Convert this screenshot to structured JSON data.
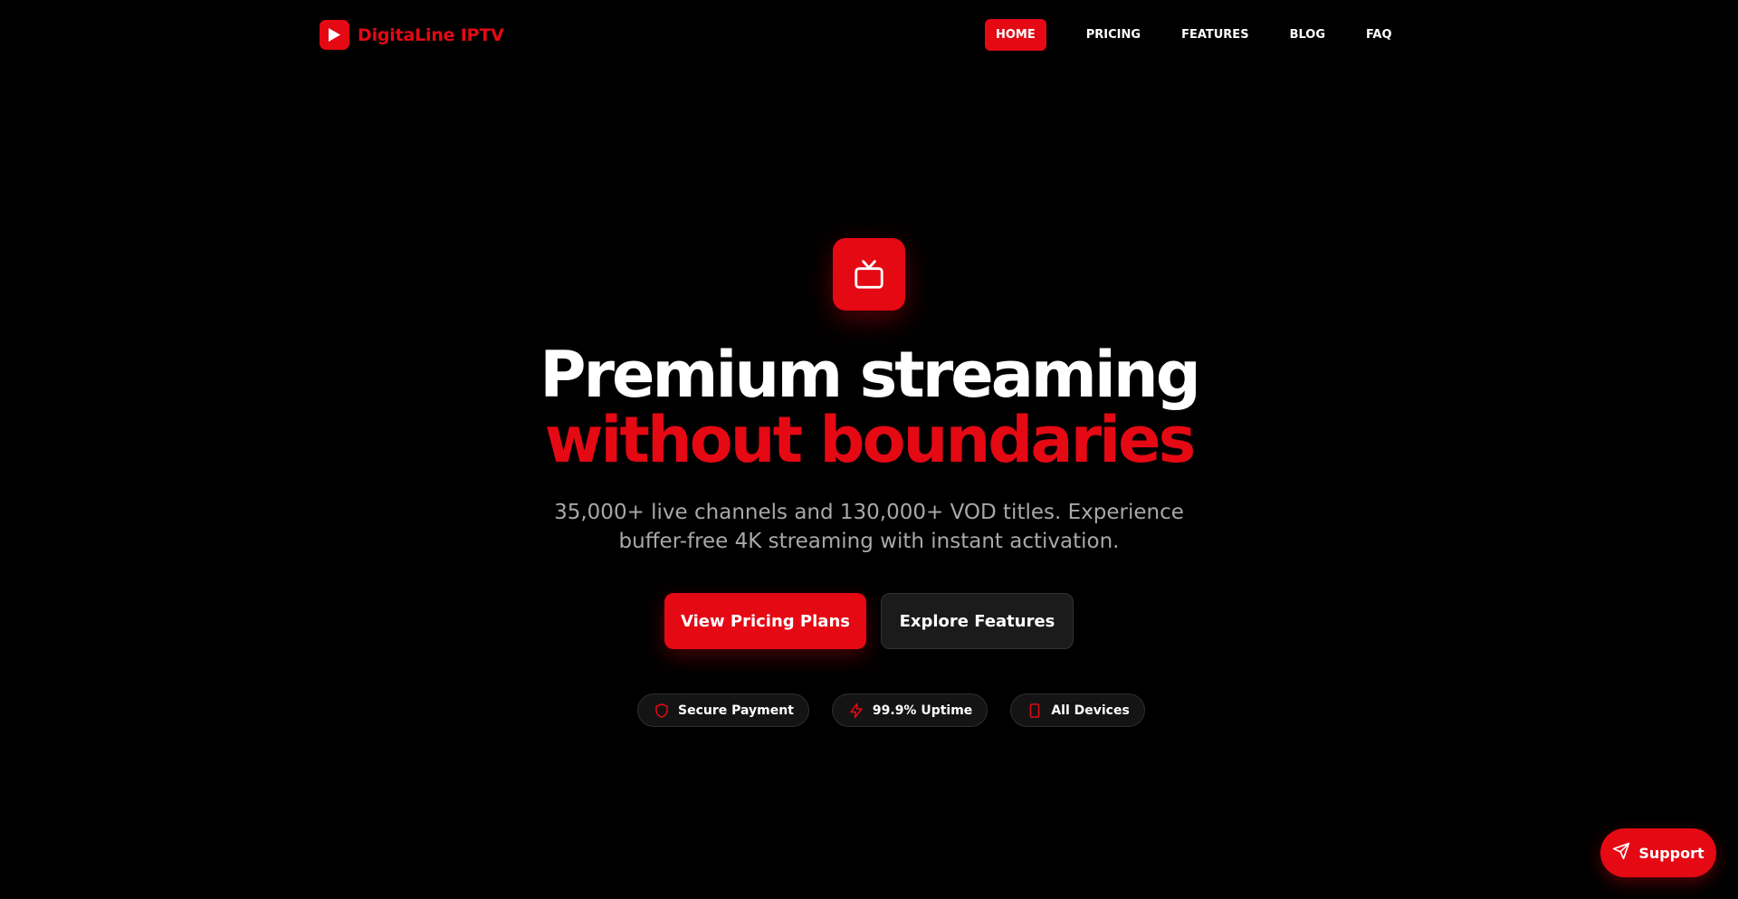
{
  "brand": {
    "name": "DigitaLine IPTV",
    "accent_color": "#e50914",
    "logo_icon": "play-icon"
  },
  "nav": {
    "items": [
      {
        "label": "HOME",
        "active": true
      },
      {
        "label": "PRICING",
        "active": false
      },
      {
        "label": "FEATURES",
        "active": false
      },
      {
        "label": "BLOG",
        "active": false
      },
      {
        "label": "FAQ",
        "active": false
      }
    ]
  },
  "hero": {
    "icon": "tv-icon",
    "title_line1": "Premium streaming",
    "title_line2": "without boundaries",
    "subtitle": "35,000+ live channels and 130,000+ VOD titles. Experience buffer-free 4K streaming with instant activation.",
    "primary_cta": "View Pricing Plans",
    "secondary_cta": "Explore Features"
  },
  "badges": [
    {
      "icon": "shield-icon",
      "label": "Secure Payment"
    },
    {
      "icon": "lightning-icon",
      "label": "99.9% Uptime"
    },
    {
      "icon": "smartphone-icon",
      "label": "All Devices"
    }
  ],
  "support": {
    "icon": "send-icon",
    "label": "Support"
  }
}
